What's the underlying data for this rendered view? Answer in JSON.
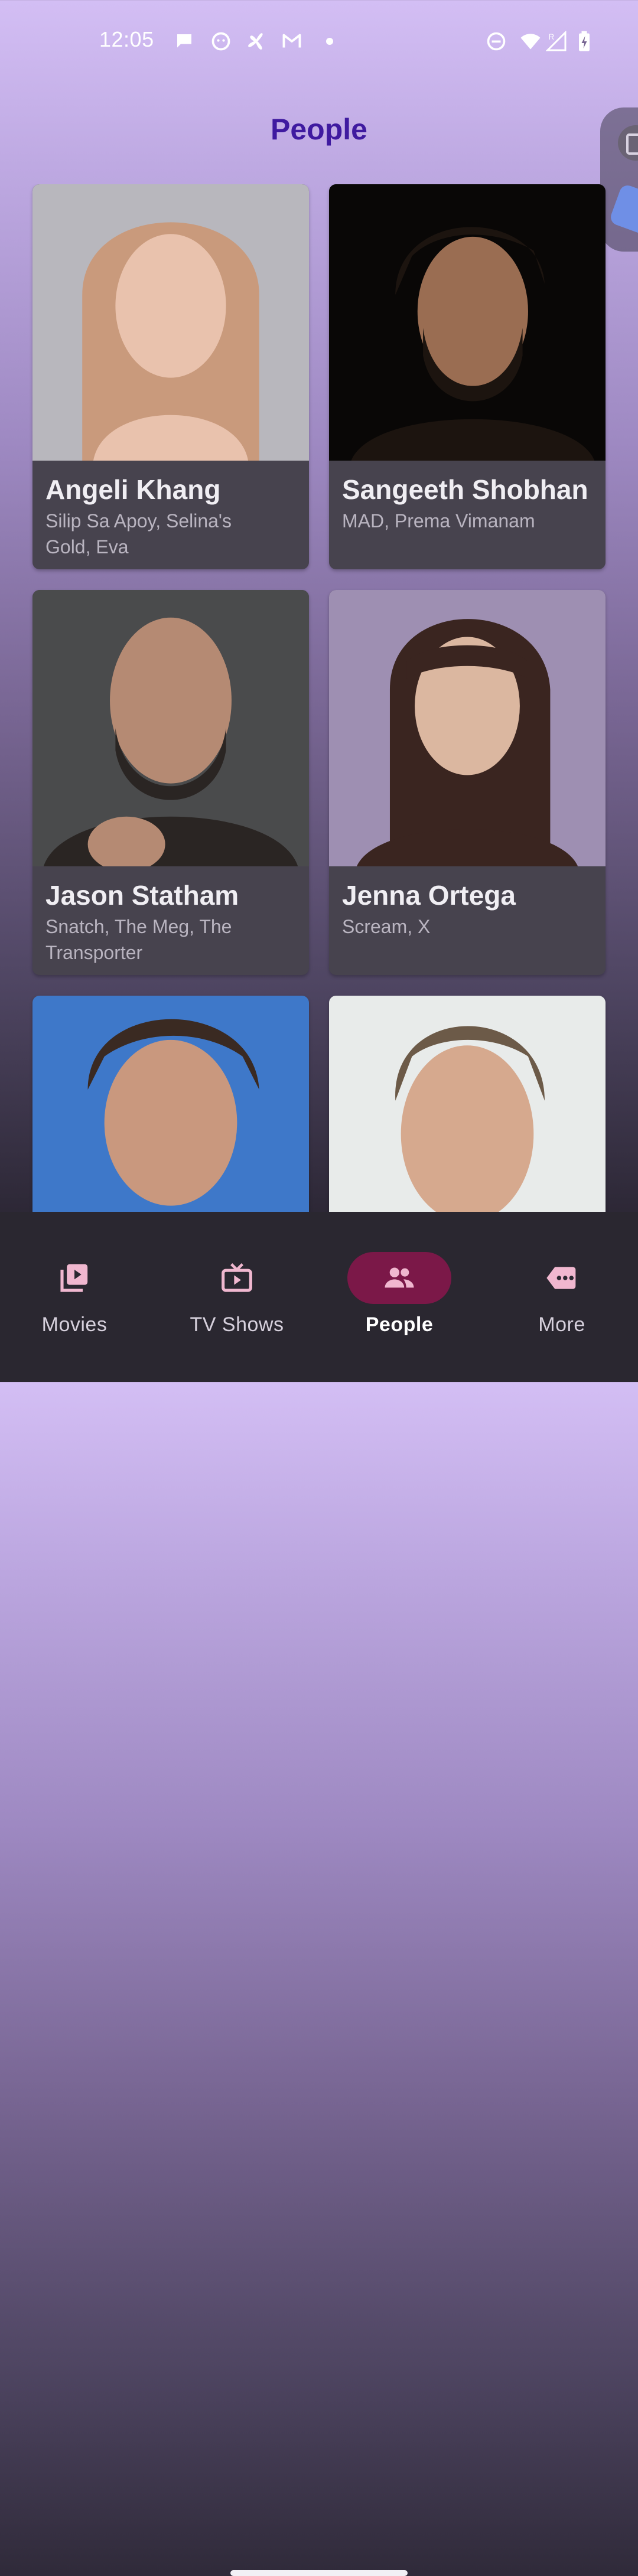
{
  "status_bar": {
    "time": "12:05",
    "notification_icons": [
      "chat-bubble-icon",
      "face-icon",
      "pinwheel-icon",
      "gmail-icon",
      "dot-icon"
    ],
    "system_icons": [
      "do-not-disturb-icon",
      "wifi-icon",
      "signal-roaming-icon",
      "battery-charging-icon"
    ],
    "signal_label": "R"
  },
  "page": {
    "title": "People"
  },
  "people": [
    {
      "name": "Angeli Khang",
      "known_for": "Silip Sa Apoy, Selina's Gold, Eva",
      "photo_colors": [
        "#b8b7bd",
        "#c99a7c",
        "#e9c2ad"
      ]
    },
    {
      "name": "Sangeeth Shobhan",
      "known_for": "MAD, Prema Vimanam",
      "photo_colors": [
        "#090706",
        "#1c140f",
        "#9a6d52"
      ]
    },
    {
      "name": "Jason Statham",
      "known_for": "Snatch, The Meg, The Transporter",
      "photo_colors": [
        "#4a4b4c",
        "#2a2523",
        "#b58a73"
      ]
    },
    {
      "name": "Jenna Ortega",
      "known_for": "Scream, X",
      "photo_colors": [
        "#9e8fb2",
        "#3a2520",
        "#dbb7a0"
      ]
    },
    {
      "name": "",
      "known_for": "",
      "photo_colors": [
        "#3e78c9",
        "#3a2a22",
        "#c9987e"
      ]
    },
    {
      "name": "",
      "known_for": "",
      "photo_colors": [
        "#e8ebea",
        "#6c5a48",
        "#d6a98e"
      ]
    }
  ],
  "bottom_nav": {
    "items": [
      {
        "label": "Movies",
        "icon": "movie-library-icon",
        "active": false
      },
      {
        "label": "TV Shows",
        "icon": "tv-icon",
        "active": false
      },
      {
        "label": "People",
        "icon": "people-icon",
        "active": true
      },
      {
        "label": "More",
        "icon": "more-tag-icon",
        "active": false
      }
    ],
    "accent_color": "#7b1848",
    "icon_color": "#f0b7cf"
  }
}
